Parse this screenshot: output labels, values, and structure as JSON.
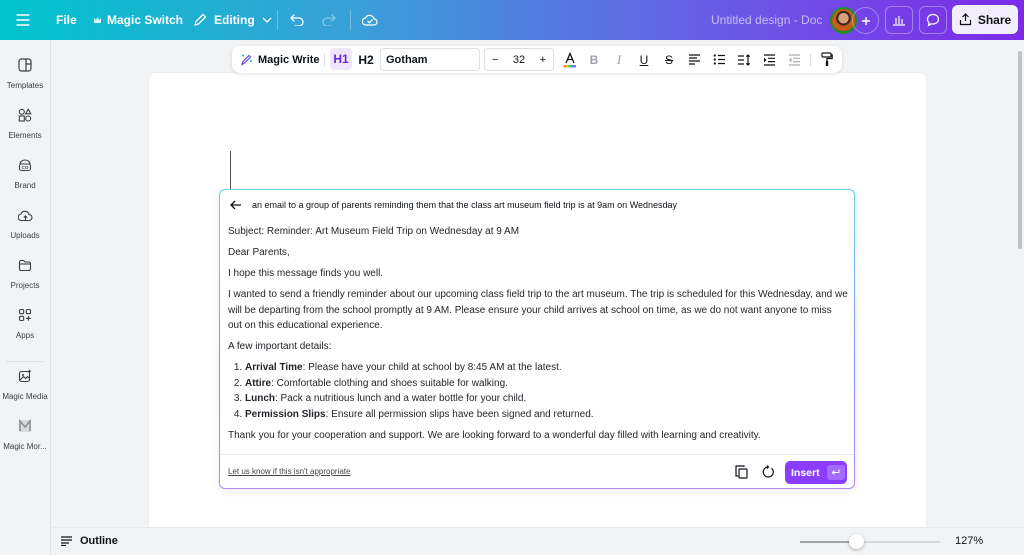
{
  "topbar": {
    "menu_icon": "hamburger-icon",
    "file_label": "File",
    "magic_switch_label": "Magic Switch",
    "editing_label": "Editing",
    "doc_title": "Untitled design - Doc",
    "share_label": "Share"
  },
  "sidebar": {
    "items": [
      {
        "label": "Templates",
        "icon": "templates-icon"
      },
      {
        "label": "Elements",
        "icon": "elements-icon"
      },
      {
        "label": "Brand",
        "icon": "brand-icon"
      },
      {
        "label": "Uploads",
        "icon": "uploads-icon"
      },
      {
        "label": "Projects",
        "icon": "folder-icon"
      },
      {
        "label": "Apps",
        "icon": "apps-icon"
      },
      {
        "label": "Magic Media",
        "icon": "magic-media-icon"
      },
      {
        "label": "Magic Mor...",
        "icon": "magic-morph-icon"
      }
    ]
  },
  "format_toolbar": {
    "magic_write_label": "Magic Write",
    "h1_label": "H1",
    "h2_label": "H2",
    "font_name": "Gotham",
    "font_size": "32",
    "decrease_label": "−",
    "increase_label": "+"
  },
  "magic_write": {
    "prompt": "an email to a group of parents reminding them that the class art museum field trip is at 9am on Wednesday",
    "subject": "Subject: Reminder: Art Museum Field Trip on Wednesday at 9 AM",
    "greeting": "Dear Parents,",
    "opening": "I hope this message finds you well.",
    "paragraph": "I wanted to send a friendly reminder about our upcoming class field trip to the art museum. The trip is scheduled for this Wednesday, and we will be departing from the school promptly at 9 AM. Please ensure your child arrives at school on time, as we do not want anyone to miss out on this educational experience.",
    "details_intro": "A few important details:",
    "details": [
      {
        "term": "Arrival Time",
        "text": ": Please have your child at school by 8:45 AM at the latest."
      },
      {
        "term": "Attire",
        "text": ": Comfortable clothing and shoes suitable for walking."
      },
      {
        "term": "Lunch",
        "text": ": Pack a nutritious lunch and a water bottle for your child."
      },
      {
        "term": "Permission Slips",
        "text": ": Ensure all permission slips have been signed and returned."
      }
    ],
    "closing": "Thank you for your cooperation and support. We are looking forward to a wonderful day filled with learning and creativity.",
    "report_link": "Let us know if this isn't appropriate",
    "insert_label": "Insert"
  },
  "bottombar": {
    "outline_label": "Outline",
    "zoom_level": "127%",
    "zoom_slider_fraction": 0.4,
    "help_label": "?"
  },
  "colors": {
    "accent_purple": "#8b3dff",
    "h1_active_bg": "#efe6fc",
    "gradient_start": "#00c4cc",
    "gradient_end": "#7d2ae8"
  }
}
